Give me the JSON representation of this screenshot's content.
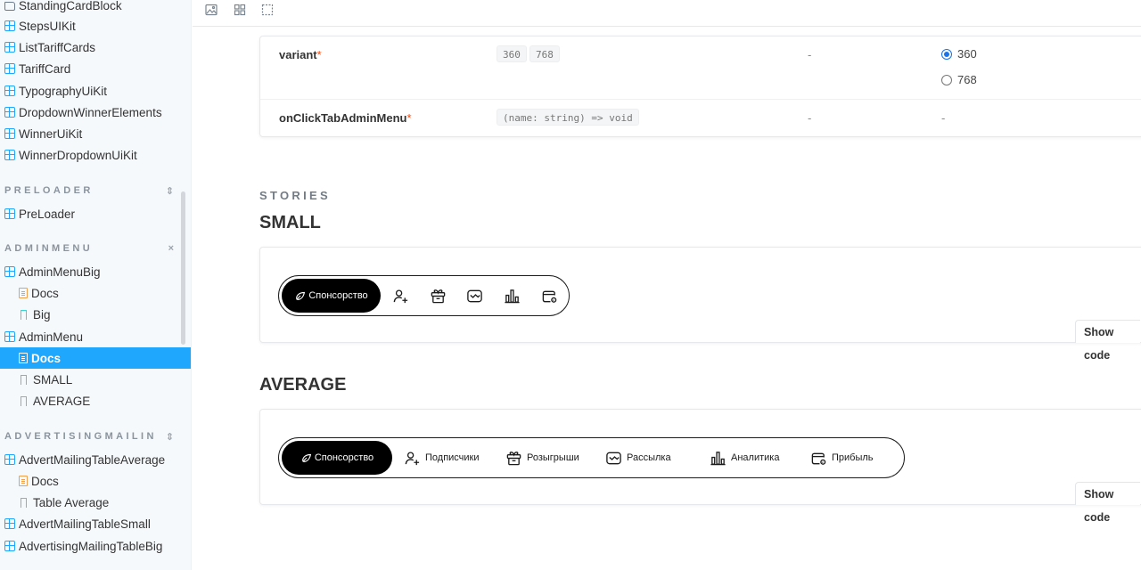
{
  "sidebar": {
    "items_top": [
      {
        "label": "StandingCardBlock",
        "icon": "folder-icon"
      },
      {
        "label": "StepsUIKit",
        "icon": "component-icon"
      },
      {
        "label": "ListTariffCards",
        "icon": "component-icon"
      },
      {
        "label": "TariffCard",
        "icon": "component-icon"
      },
      {
        "label": "TypographyUiKit",
        "icon": "component-icon"
      },
      {
        "label": "DropdownWinnerElements",
        "icon": "component-icon"
      },
      {
        "label": "WinnerUiKit",
        "icon": "component-icon"
      },
      {
        "label": "WinnerDropdownUiKit",
        "icon": "component-icon"
      }
    ],
    "sections": {
      "preloader": {
        "title": "PRELOADER",
        "items": [
          "PreLoader"
        ]
      },
      "adminmenu": {
        "title": "ADMINMENU",
        "items": [
          "AdminMenuBig",
          "Docs",
          "Big",
          "AdminMenu",
          "Docs",
          "SMALL",
          "AVERAGE"
        ]
      },
      "advertising": {
        "title": "ADVERTISINGMAILIN",
        "items": [
          "AdvertMailingTableAverage",
          "Docs",
          "Table Average",
          "AdvertMailingTableSmall",
          "AdvertisingMailingTableBig"
        ]
      }
    }
  },
  "toolbar": {
    "icons": [
      "image-icon",
      "grid-icon",
      "outline-icon"
    ]
  },
  "props": {
    "rows": [
      {
        "name": "variant",
        "required": "*",
        "type_values": [
          "360",
          "768"
        ],
        "default": "-",
        "control": {
          "options": [
            "360",
            "768"
          ],
          "selected": "360"
        }
      },
      {
        "name": "onClickTabAdminMenu",
        "required": "*",
        "type_signature": "(name: string) => void",
        "default": "-",
        "control_value": "-"
      }
    ]
  },
  "stories": {
    "label": "STORIES",
    "small": {
      "title": "SMALL",
      "show_code": "Show code"
    },
    "average": {
      "title": "AVERAGE",
      "show_code": "Show code"
    }
  },
  "admin_menu": {
    "active_tab": "Спонсорство",
    "tabs": [
      {
        "label": "Подписчики",
        "icon": "subscribers-icon"
      },
      {
        "label": "Розыгрыши",
        "icon": "giveaway-icon"
      },
      {
        "label": "Рассылка",
        "icon": "mailing-icon"
      },
      {
        "label": "Аналитика",
        "icon": "analytics-icon"
      },
      {
        "label": "Прибыль",
        "icon": "wallet-icon"
      }
    ]
  }
}
